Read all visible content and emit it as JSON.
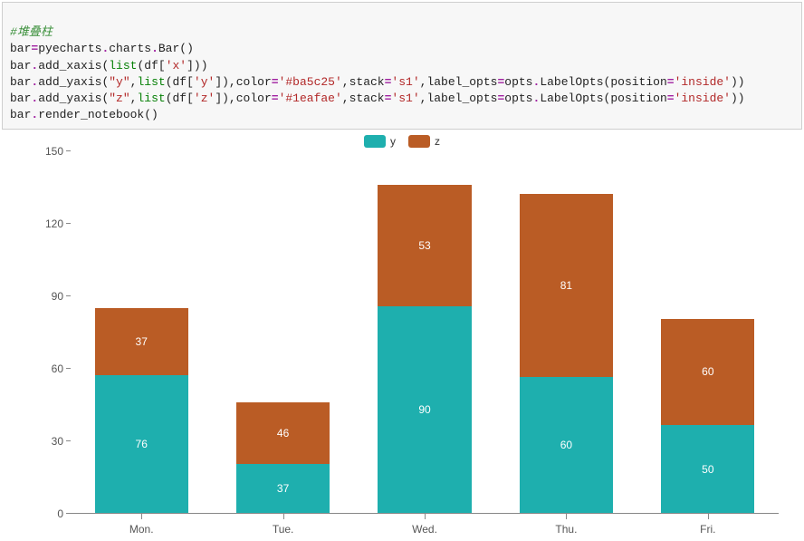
{
  "code": {
    "comment_prefix": "#",
    "comment_text": "堆叠柱",
    "line2_a": "bar",
    "line2_b": "pyecharts",
    "line2_c": "charts",
    "line2_d": "Bar",
    "line3_a": "bar",
    "line3_b": "add_xaxis",
    "line3_c": "list",
    "line3_d": "df",
    "line3_e": "'x'",
    "line4_a": "bar",
    "line4_b": "add_yaxis",
    "line4_c": "\"y\"",
    "line4_d": "list",
    "line4_e": "df",
    "line4_f": "'y'",
    "line4_g": "color",
    "line4_h": "'#ba5c25'",
    "line4_i": "stack",
    "line4_j": "'s1'",
    "line4_k": "label_opts",
    "line4_l": "opts",
    "line4_m": "LabelOpts",
    "line4_n": "position",
    "line4_o": "'inside'",
    "line5_a": "bar",
    "line5_b": "add_yaxis",
    "line5_c": "\"z\"",
    "line5_d": "list",
    "line5_e": "df",
    "line5_f": "'z'",
    "line5_g": "color",
    "line5_h": "'#1eafae'",
    "line5_i": "stack",
    "line5_j": "'s1'",
    "line5_k": "label_opts",
    "line5_l": "opts",
    "line5_m": "LabelOpts",
    "line5_n": "position",
    "line5_o": "'inside'",
    "line6_a": "bar",
    "line6_b": "render_notebook"
  },
  "legend": {
    "items": [
      {
        "label": "y",
        "color": "#1eafae"
      },
      {
        "label": "z",
        "color": "#ba5c25"
      }
    ]
  },
  "chart_data": {
    "type": "bar",
    "stacked": true,
    "categories": [
      "Mon.",
      "Tue.",
      "Wed.",
      "Thu.",
      "Fri."
    ],
    "series": [
      {
        "name": "y",
        "color": "#1eafae",
        "values": [
          76,
          37,
          90,
          60,
          50
        ]
      },
      {
        "name": "z",
        "color": "#ba5c25",
        "values": [
          37,
          46,
          53,
          81,
          60
        ]
      }
    ],
    "ylim": [
      0,
      150
    ],
    "yticks": [
      0,
      30,
      60,
      90,
      120,
      150
    ],
    "xlabel": "",
    "ylabel": "",
    "title": ""
  }
}
